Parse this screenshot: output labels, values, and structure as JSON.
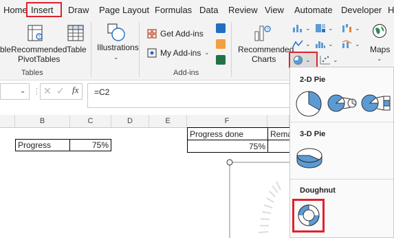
{
  "tabs": [
    "Home",
    "Insert",
    "Draw",
    "Page Layout",
    "Formulas",
    "Data",
    "Review",
    "View",
    "Automate",
    "Developer",
    "H"
  ],
  "ribbon": {
    "pivot_partial": "ble",
    "recommended_pivot_1": "Recommended",
    "recommended_pivot_2": "PivotTables",
    "table": "Table",
    "tables_group": "Tables",
    "illustrations": "Illustrations",
    "get_addins": "Get Add-ins",
    "my_addins": "My Add-ins",
    "addins_group": "Add-ins",
    "recommended_charts_1": "Recommended",
    "recommended_charts_2": "Charts",
    "maps": "Maps"
  },
  "formula_bar": {
    "fx": "fx",
    "formula": "=C2"
  },
  "columns": [
    "B",
    "C",
    "D",
    "E",
    "F"
  ],
  "cells": {
    "progress_label": "Progress",
    "progress_value": "75%",
    "progress_done_label": "Progress done",
    "progress_done_value": "75%",
    "remaining_partial": "Rema"
  },
  "dropdown": {
    "pie2d": "2-D Pie",
    "pie3d": "3-D Pie",
    "doughnut": "Doughnut"
  },
  "colors": {
    "accent": "#e0212b",
    "pie_blue": "#5b9bd5",
    "excel_green": "#217346"
  }
}
